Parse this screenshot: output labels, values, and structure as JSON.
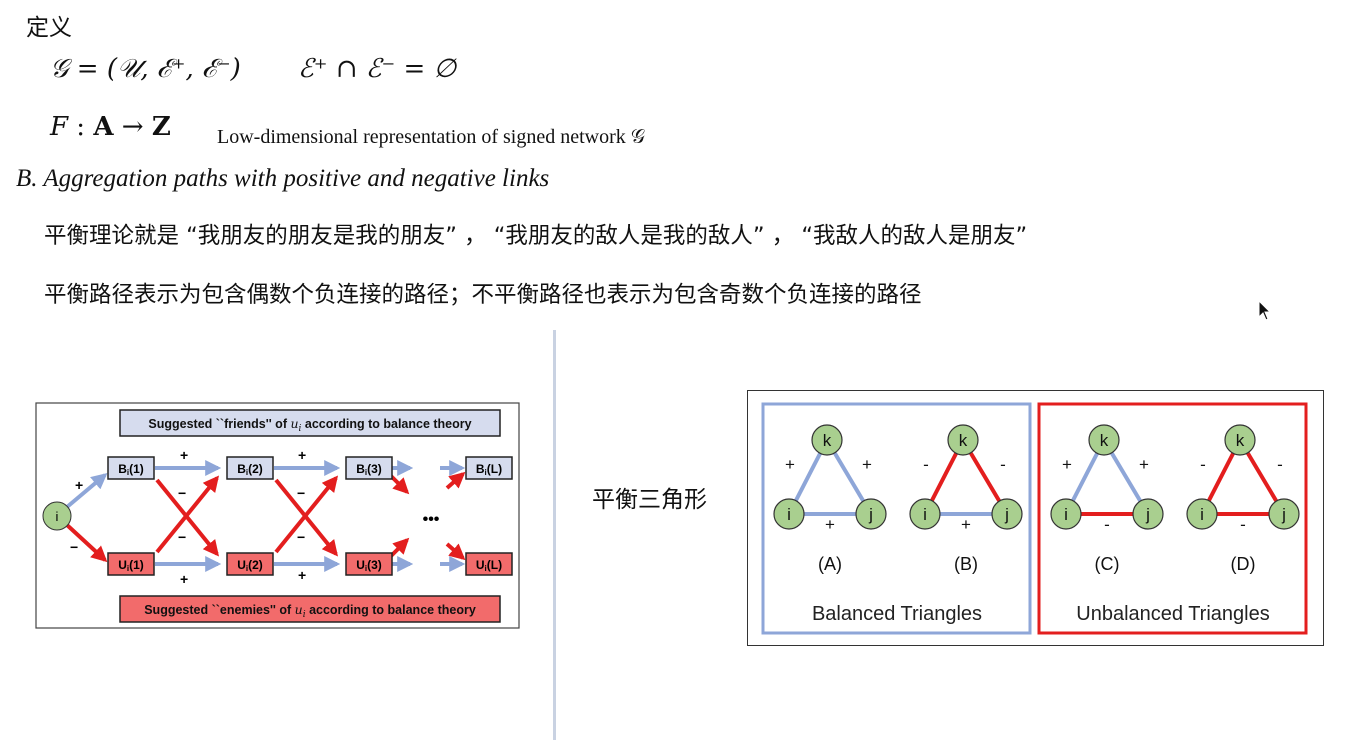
{
  "definition_title": "定义",
  "math": {
    "signed_graph": "𝒢  =  (𝒰, ℰ⁺, ℰ⁻)",
    "disjoint": "ℰ⁺ ∩ ℰ⁻ = ∅",
    "mapping_F": "F",
    "mapping_rest": " : ",
    "mapping_A": "A",
    "mapping_arrow": " → ",
    "mapping_Z": "Z",
    "mapping_note": "Low-dimensional representation of signed network 𝒢"
  },
  "section_b": "B.  Aggregation paths with positive and negative links",
  "para_balance": "平衡理论就是 “我朋友的朋友是我的朋友” ，  “我朋友的敌人是我的敌人” ，  “我敌人的敌人是朋友”",
  "para_paths": "平衡路径表示为包含偶数个负连接的路径；不平衡路径也表示为包含奇数个负连接的路径",
  "triangle_caption": "平衡三角形",
  "colors": {
    "positive": "#8ea6d8",
    "negative": "#e31e1e",
    "node": "#a9cf8f",
    "box_blue": "#d6dcee",
    "box_red": "#f26b6b"
  },
  "diagram_paths": {
    "friends_banner_pre": "Suggested ``friends'' of ",
    "enemies_banner_pre": "Suggested ``enemies'' of ",
    "banner_var": "u",
    "banner_sub": "i",
    "banner_post": " according to balance theory",
    "start_node": "i",
    "b_nodes": [
      {
        "main": "B",
        "sub": "i",
        "idx": "(1)"
      },
      {
        "main": "B",
        "sub": "i",
        "idx": "(2)"
      },
      {
        "main": "B",
        "sub": "i",
        "idx": "(3)"
      },
      {
        "main": "B",
        "sub": "i",
        "idx": "(L)"
      }
    ],
    "u_nodes": [
      {
        "main": "U",
        "sub": "i",
        "idx": "(1)"
      },
      {
        "main": "U",
        "sub": "i",
        "idx": "(2)"
      },
      {
        "main": "U",
        "sub": "i",
        "idx": "(3)"
      },
      {
        "main": "U",
        "sub": "i",
        "idx": "(L)"
      }
    ],
    "plus": "+",
    "minus": "−",
    "ellipsis": "•••"
  },
  "diagram_triangles": {
    "node_top": "k",
    "node_left": "i",
    "node_right": "j",
    "panels": [
      {
        "label": "(A)",
        "left_sign": "+",
        "right_sign": "+",
        "bottom_sign": "+",
        "left_type": "positive",
        "right_type": "positive",
        "bottom_type": "positive"
      },
      {
        "label": "(B)",
        "left_sign": "-",
        "right_sign": "-",
        "bottom_sign": "+",
        "left_type": "negative",
        "right_type": "negative",
        "bottom_type": "positive"
      },
      {
        "label": "(C)",
        "left_sign": "+",
        "right_sign": "+",
        "bottom_sign": "-",
        "left_type": "positive",
        "right_type": "positive",
        "bottom_type": "negative"
      },
      {
        "label": "(D)",
        "left_sign": "-",
        "right_sign": "-",
        "bottom_sign": "-",
        "left_type": "negative",
        "right_type": "negative",
        "bottom_type": "negative"
      }
    ],
    "balanced_title": "Balanced Triangles",
    "unbalanced_title": "Unbalanced Triangles"
  }
}
